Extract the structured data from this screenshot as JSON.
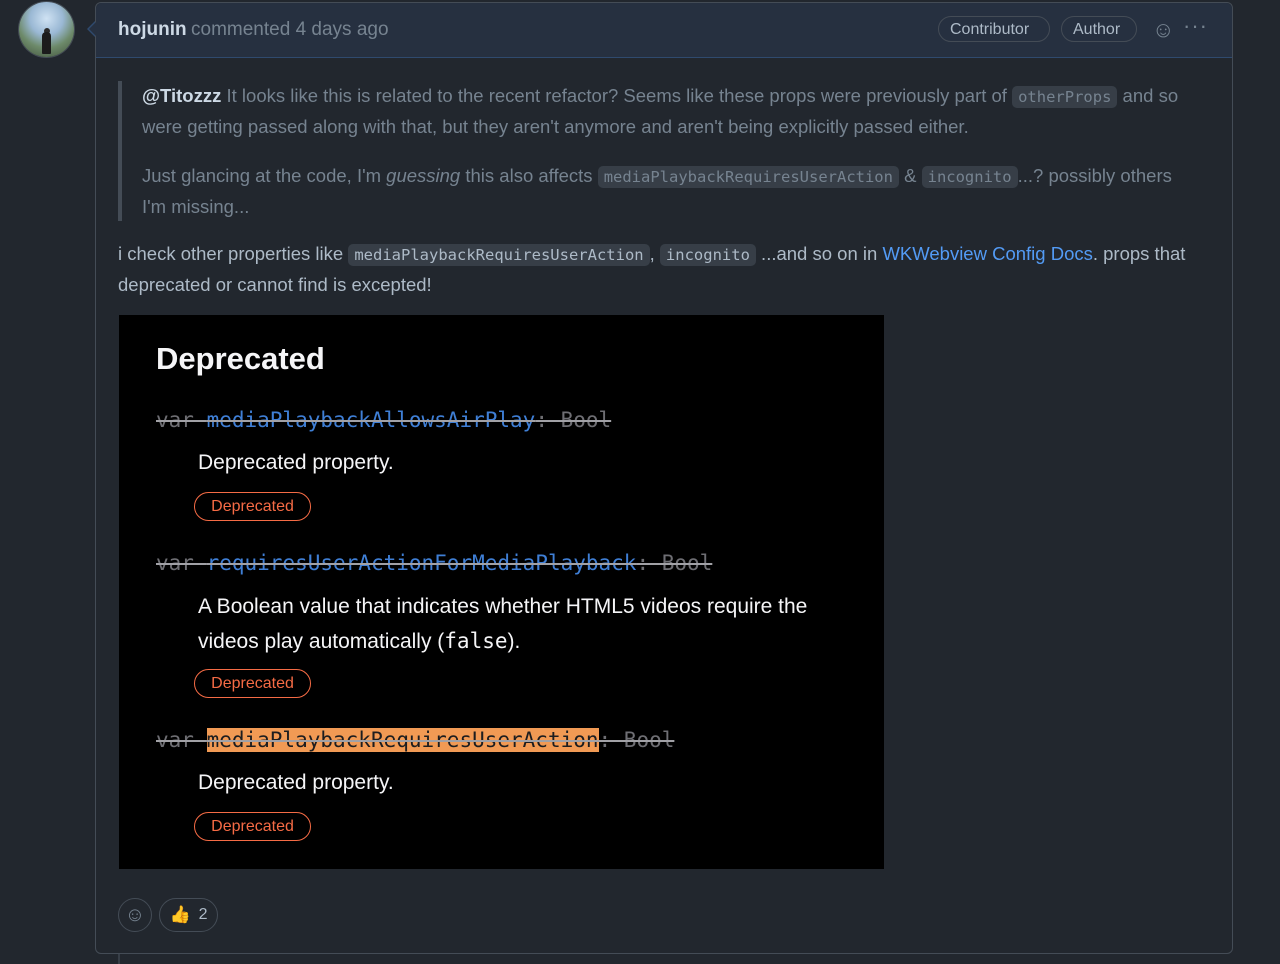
{
  "comment": {
    "author": "hojunin",
    "action": "commented",
    "time": "4 days ago",
    "badges": [
      "Contributor",
      "Author"
    ],
    "icons": {
      "reaction": "smiley-icon",
      "menu": "kebab-menu-icon"
    }
  },
  "quote": {
    "mention": "@Titozzz",
    "p1_text1": " It looks like this is related to the recent refactor? Seems like these props were previously part of ",
    "p1_code": "otherProps",
    "p1_text2": " and so were getting passed along with that, but they aren't anymore and aren't being explicitly passed either.",
    "p2_text1": "Just glancing at the code, I'm ",
    "p2_em": "guessing",
    "p2_text2": " this also affects ",
    "p2_code1": "mediaPlaybackRequiresUserAction",
    "p2_amp": " & ",
    "p2_code2": "incognito",
    "p2_text3": "...? possibly others I'm missing..."
  },
  "body": {
    "text1": "i check other properties like ",
    "code1": "mediaPlaybackRequiresUserAction",
    "comma": ", ",
    "code2": "incognito",
    "text2": " ...and so on in ",
    "link": "WKWebview Config Docs",
    "text3": ". props that deprecated or cannot find is excepted!"
  },
  "doc_image": {
    "title": "Deprecated",
    "entries": [
      {
        "kw": "var ",
        "name": "mediaPlaybackAllowsAirPlay",
        "type": ": Bool",
        "desc1": "Deprecated property.",
        "badge": "Deprecated"
      },
      {
        "kw": "var ",
        "name": "requiresUserActionForMediaPlayback",
        "type": ": Bool",
        "desc1": "A Boolean value that indicates whether HTML5 videos require the",
        "desc2_a": "videos play automatically (",
        "desc2_mono": "false",
        "desc2_b": ").",
        "badge": "Deprecated"
      },
      {
        "kw": "var ",
        "name": "mediaPlaybackRequiresUserAction",
        "type": ": Bool",
        "desc1": "Deprecated property.",
        "badge": "Deprecated"
      }
    ]
  },
  "reactions": {
    "add_icon": "smiley-icon",
    "thumbs_icon": "thumbs-up-icon",
    "thumbs_count": "2"
  }
}
